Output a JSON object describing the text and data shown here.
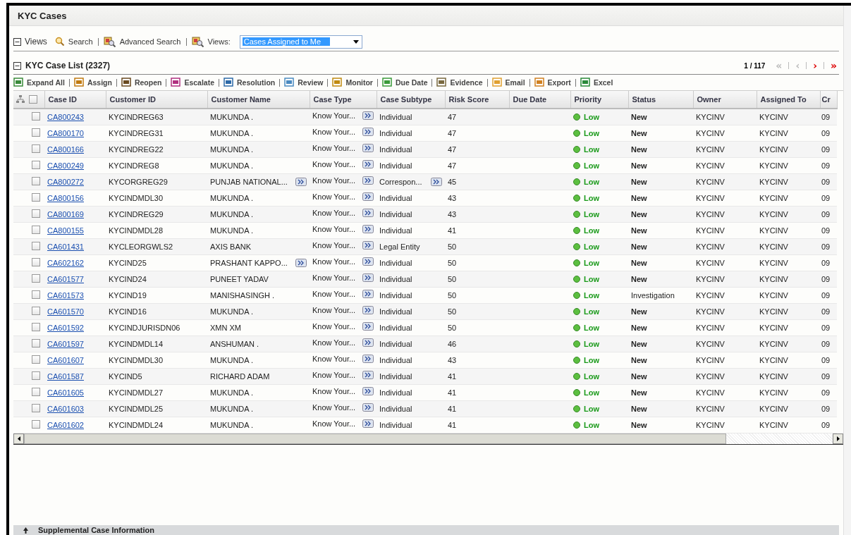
{
  "window": {
    "title": "KYC Cases"
  },
  "views_bar": {
    "label": "Views",
    "expanded": true,
    "search": "Search",
    "advanced_search": "Advanced Search",
    "views_label": "Views:",
    "views_select": {
      "value": "Cases Assigned to Me"
    }
  },
  "case_list": {
    "title": "KYC Case List (2327)",
    "expanded": true,
    "select_all_checked": false,
    "pager": {
      "text": "1 / 117",
      "buttons": [
        {
          "label": "«",
          "disabled": true
        },
        {
          "label": "‹",
          "disabled": true
        },
        {
          "label": "›",
          "disabled": false
        },
        {
          "label": "»",
          "disabled": false
        }
      ]
    },
    "toolbar": [
      "Expand All",
      "Assign",
      "Reopen",
      "Escalate",
      "Resolution",
      "Review",
      "Monitor",
      "Due Date",
      "Evidence",
      "Email",
      "Export",
      "Excel"
    ],
    "columns": [
      "Case ID",
      "Customer ID",
      "Customer Name",
      "Case Type",
      "Case Subtype",
      "Risk Score",
      "Due Date",
      "Priority",
      "Status",
      "Owner",
      "Assigned To",
      "Cr"
    ],
    "rows": [
      {
        "checked": false,
        "case_id": "CA800243",
        "customer_id": "KYCINDREG63",
        "customer_name": "MUKUNDA .",
        "name_more": false,
        "case_type": "Know Your...",
        "subtype": "Individual",
        "subtype_more": false,
        "risk": "47",
        "due": "",
        "priority": "Low",
        "status": "New",
        "status_bold": true,
        "owner": "KYCINV",
        "assigned": "KYCINV",
        "column_13": "09"
      },
      {
        "checked": false,
        "case_id": "CA800170",
        "customer_id": "KYCINDREG31",
        "customer_name": "MUKUNDA .",
        "name_more": false,
        "case_type": "Know Your...",
        "subtype": "Individual",
        "subtype_more": false,
        "risk": "47",
        "due": "",
        "priority": "Low",
        "status": "New",
        "status_bold": true,
        "owner": "KYCINV",
        "assigned": "KYCINV",
        "column_13": "09"
      },
      {
        "checked": false,
        "case_id": "CA800166",
        "customer_id": "KYCINDREG22",
        "customer_name": "MUKUNDA .",
        "name_more": false,
        "case_type": "Know Your...",
        "subtype": "Individual",
        "subtype_more": false,
        "risk": "47",
        "due": "",
        "priority": "Low",
        "status": "New",
        "status_bold": true,
        "owner": "KYCINV",
        "assigned": "KYCINV",
        "column_13": "09"
      },
      {
        "checked": false,
        "case_id": "CA800249",
        "customer_id": "KYCINDREG8",
        "customer_name": "MUKUNDA .",
        "name_more": false,
        "case_type": "Know Your...",
        "subtype": "Individual",
        "subtype_more": false,
        "risk": "47",
        "due": "",
        "priority": "Low",
        "status": "New",
        "status_bold": true,
        "owner": "KYCINV",
        "assigned": "KYCINV",
        "column_13": "09"
      },
      {
        "checked": false,
        "case_id": "CA800272",
        "customer_id": "KYCORGREG29",
        "customer_name": "PUNJAB NATIONAL...",
        "name_more": true,
        "case_type": "Know Your...",
        "subtype": "Correspon...",
        "subtype_more": true,
        "risk": "45",
        "due": "",
        "priority": "Low",
        "status": "New",
        "status_bold": true,
        "owner": "KYCINV",
        "assigned": "KYCINV",
        "column_13": "09"
      },
      {
        "checked": false,
        "case_id": "CA800156",
        "customer_id": "KYCINDMDL30",
        "customer_name": "MUKUNDA .",
        "name_more": false,
        "case_type": "Know Your...",
        "subtype": "Individual",
        "subtype_more": false,
        "risk": "43",
        "due": "",
        "priority": "Low",
        "status": "New",
        "status_bold": true,
        "owner": "KYCINV",
        "assigned": "KYCINV",
        "column_13": "09"
      },
      {
        "checked": false,
        "case_id": "CA800169",
        "customer_id": "KYCINDREG29",
        "customer_name": "MUKUNDA .",
        "name_more": false,
        "case_type": "Know Your...",
        "subtype": "Individual",
        "subtype_more": false,
        "risk": "43",
        "due": "",
        "priority": "Low",
        "status": "New",
        "status_bold": true,
        "owner": "KYCINV",
        "assigned": "KYCINV",
        "column_13": "09"
      },
      {
        "checked": false,
        "case_id": "CA800155",
        "customer_id": "KYCINDMDL28",
        "customer_name": "MUKUNDA .",
        "name_more": false,
        "case_type": "Know Your...",
        "subtype": "Individual",
        "subtype_more": false,
        "risk": "41",
        "due": "",
        "priority": "Low",
        "status": "New",
        "status_bold": true,
        "owner": "KYCINV",
        "assigned": "KYCINV",
        "column_13": "09"
      },
      {
        "checked": false,
        "case_id": "CA601431",
        "customer_id": "KYCLEORGWLS2",
        "customer_name": "AXIS BANK",
        "name_more": false,
        "case_type": "Know Your...",
        "subtype": "Legal Entity",
        "subtype_more": false,
        "risk": "50",
        "due": "",
        "priority": "Low",
        "status": "New",
        "status_bold": true,
        "owner": "KYCINV",
        "assigned": "KYCINV",
        "column_13": "09"
      },
      {
        "checked": false,
        "case_id": "CA602162",
        "customer_id": "KYCIND25",
        "customer_name": "PRASHANT KAPPO...",
        "name_more": true,
        "case_type": "Know Your...",
        "subtype": "Individual",
        "subtype_more": false,
        "risk": "50",
        "due": "",
        "priority": "Low",
        "status": "New",
        "status_bold": true,
        "owner": "KYCINV",
        "assigned": "KYCINV",
        "column_13": "09"
      },
      {
        "checked": false,
        "case_id": "CA601577",
        "customer_id": "KYCIND24",
        "customer_name": "PUNEET YADAV",
        "name_more": false,
        "case_type": "Know Your...",
        "subtype": "Individual",
        "subtype_more": false,
        "risk": "50",
        "due": "",
        "priority": "Low",
        "status": "New",
        "status_bold": true,
        "owner": "KYCINV",
        "assigned": "KYCINV",
        "column_13": "09"
      },
      {
        "checked": false,
        "case_id": "CA601573",
        "customer_id": "KYCIND19",
        "customer_name": "MANISHASINGH .",
        "name_more": false,
        "case_type": "Know Your...",
        "subtype": "Individual",
        "subtype_more": false,
        "risk": "50",
        "due": "",
        "priority": "Low",
        "status": "Investigation",
        "status_bold": false,
        "owner": "KYCINV",
        "assigned": "KYCINV",
        "column_13": "09"
      },
      {
        "checked": false,
        "case_id": "CA601570",
        "customer_id": "KYCIND16",
        "customer_name": "MUKUNDA .",
        "name_more": false,
        "case_type": "Know Your...",
        "subtype": "Individual",
        "subtype_more": false,
        "risk": "50",
        "due": "",
        "priority": "Low",
        "status": "New",
        "status_bold": true,
        "owner": "KYCINV",
        "assigned": "KYCINV",
        "column_13": "09"
      },
      {
        "checked": false,
        "case_id": "CA601592",
        "customer_id": "KYCINDJURISDN06",
        "customer_name": "XMN XM",
        "name_more": false,
        "case_type": "Know Your...",
        "subtype": "Individual",
        "subtype_more": false,
        "risk": "50",
        "due": "",
        "priority": "Low",
        "status": "New",
        "status_bold": true,
        "owner": "KYCINV",
        "assigned": "KYCINV",
        "column_13": "09"
      },
      {
        "checked": false,
        "case_id": "CA601597",
        "customer_id": "KYCINDMDL14",
        "customer_name": "ANSHUMAN .",
        "name_more": false,
        "case_type": "Know Your...",
        "subtype": "Individual",
        "subtype_more": false,
        "risk": "46",
        "due": "",
        "priority": "Low",
        "status": "New",
        "status_bold": true,
        "owner": "KYCINV",
        "assigned": "KYCINV",
        "column_13": "09"
      },
      {
        "checked": false,
        "case_id": "CA601607",
        "customer_id": "KYCINDMDL30",
        "customer_name": "MUKUNDA .",
        "name_more": false,
        "case_type": "Know Your...",
        "subtype": "Individual",
        "subtype_more": false,
        "risk": "43",
        "due": "",
        "priority": "Low",
        "status": "New",
        "status_bold": true,
        "owner": "KYCINV",
        "assigned": "KYCINV",
        "column_13": "09"
      },
      {
        "checked": false,
        "case_id": "CA601587",
        "customer_id": "KYCIND5",
        "customer_name": "RICHARD ADAM",
        "name_more": false,
        "case_type": "Know Your...",
        "subtype": "Individual",
        "subtype_more": false,
        "risk": "41",
        "due": "",
        "priority": "Low",
        "status": "New",
        "status_bold": true,
        "owner": "KYCINV",
        "assigned": "KYCINV",
        "column_13": "09"
      },
      {
        "checked": false,
        "case_id": "CA601605",
        "customer_id": "KYCINDMDL27",
        "customer_name": "MUKUNDA .",
        "name_more": false,
        "case_type": "Know Your...",
        "subtype": "Individual",
        "subtype_more": false,
        "risk": "41",
        "due": "",
        "priority": "Low",
        "status": "New",
        "status_bold": true,
        "owner": "KYCINV",
        "assigned": "KYCINV",
        "column_13": "09"
      },
      {
        "checked": false,
        "case_id": "CA601603",
        "customer_id": "KYCINDMDL25",
        "customer_name": "MUKUNDA .",
        "name_more": false,
        "case_type": "Know Your...",
        "subtype": "Individual",
        "subtype_more": false,
        "risk": "41",
        "due": "",
        "priority": "Low",
        "status": "New",
        "status_bold": true,
        "owner": "KYCINV",
        "assigned": "KYCINV",
        "column_13": "09"
      },
      {
        "checked": false,
        "case_id": "CA601602",
        "customer_id": "KYCINDMDL24",
        "customer_name": "MUKUNDA .",
        "name_more": false,
        "case_type": "Know Your...",
        "subtype": "Individual",
        "subtype_more": false,
        "risk": "41",
        "due": "",
        "priority": "Low",
        "status": "New",
        "status_bold": true,
        "owner": "KYCINV",
        "assigned": "KYCINV",
        "column_13": "09"
      }
    ]
  },
  "supplemental": {
    "title": "Supplemental Case Information",
    "expanded": false
  }
}
